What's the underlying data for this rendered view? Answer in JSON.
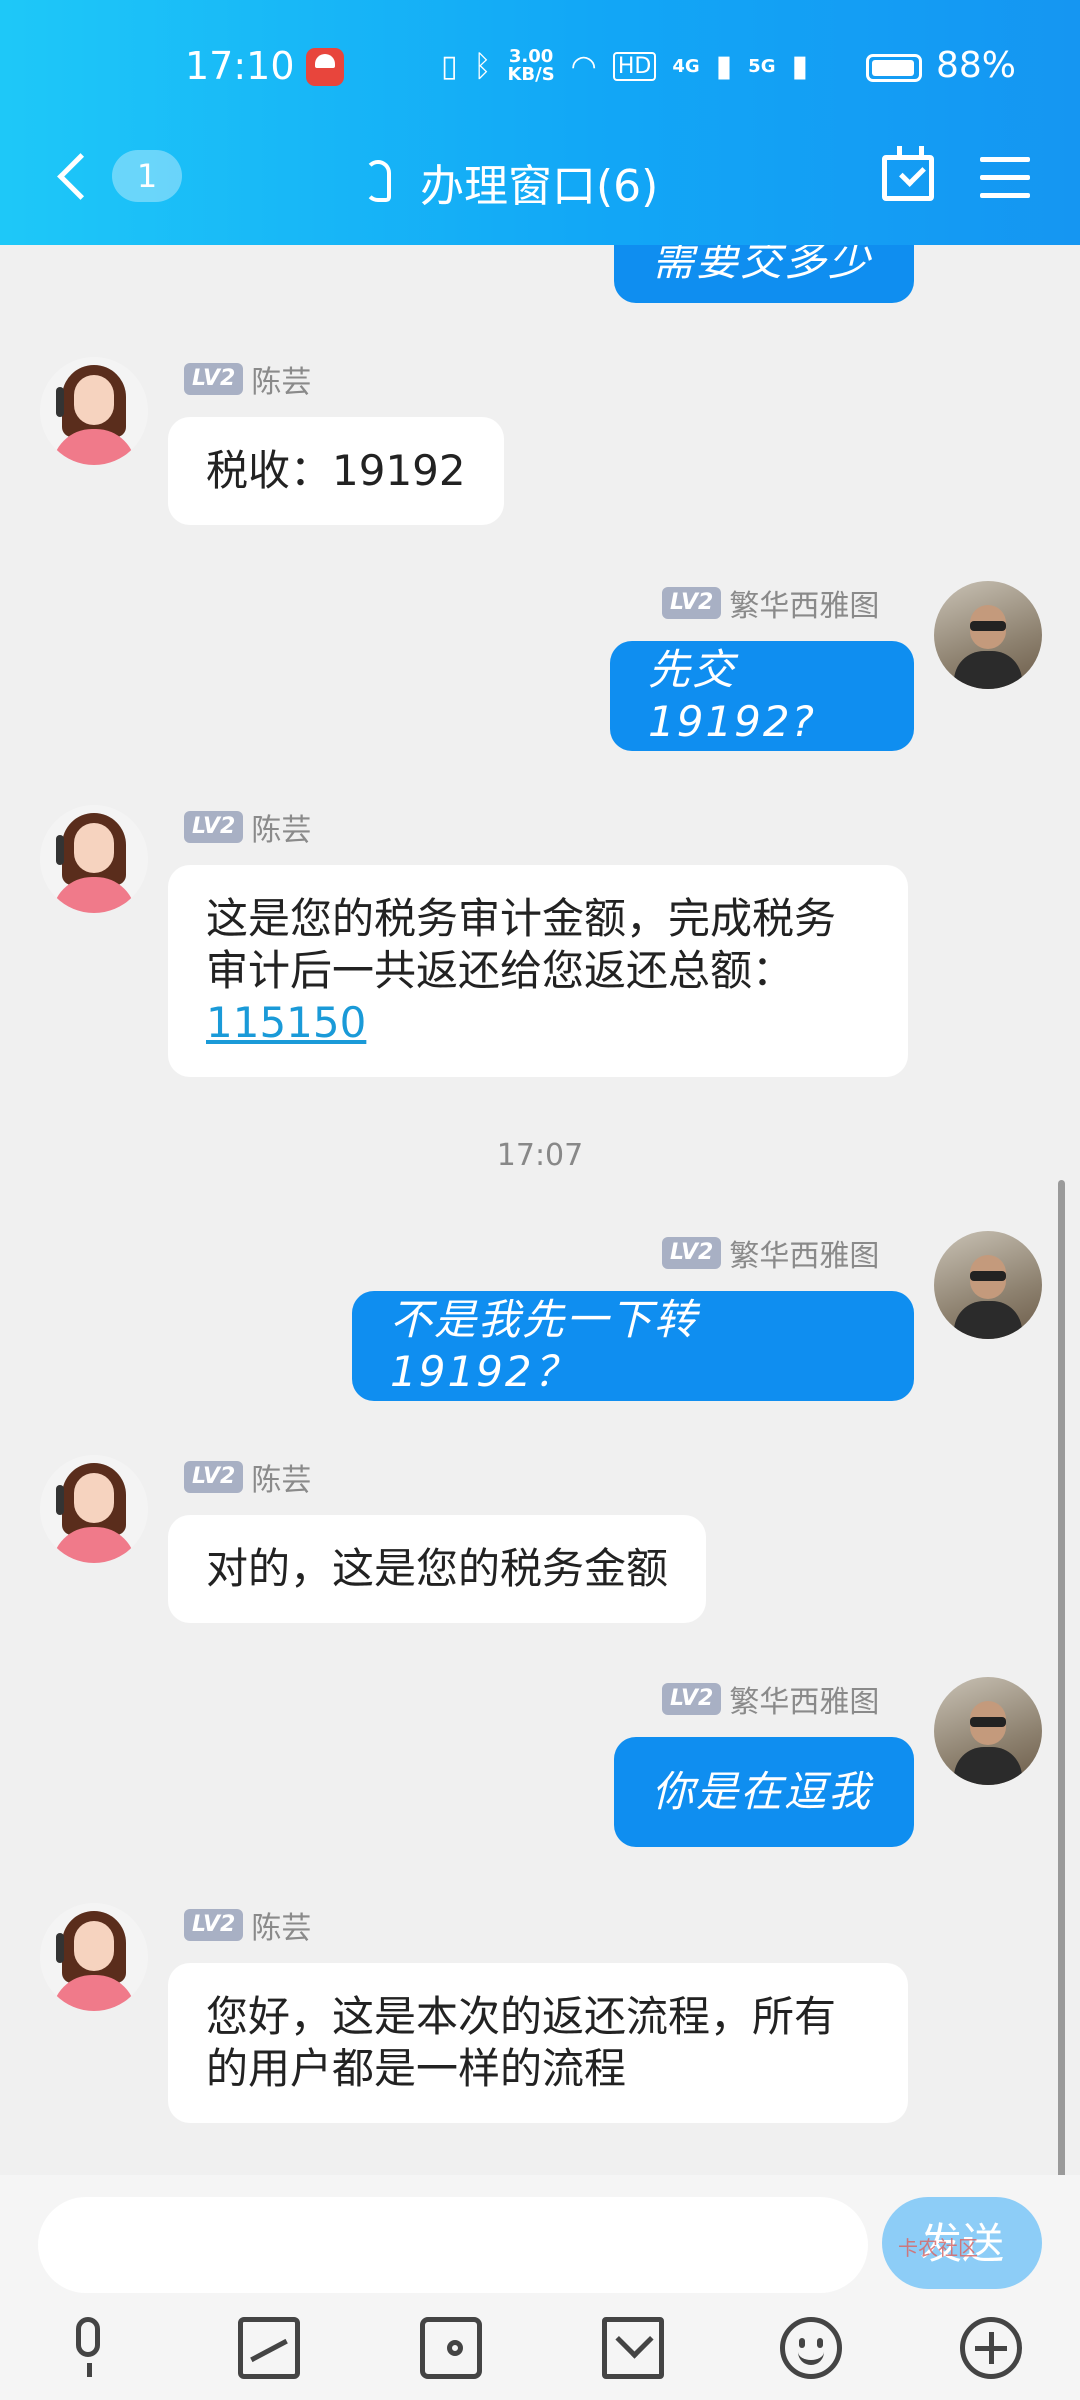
{
  "status": {
    "time": "17:10",
    "speed_value": "3.00",
    "speed_unit": "KB/S",
    "hd": "HD",
    "net1": "4G",
    "net2": "5G",
    "battery": "88%"
  },
  "header": {
    "unread_count": "1",
    "title": "办理窗口(6)"
  },
  "badge": "LV2",
  "agent_name": "陈芸",
  "user_name": "繁华西雅图",
  "top_partial_bubble": "需要交多少",
  "messages": {
    "m1": "税收：19192",
    "m2": "先交19192?",
    "m3_prefix": "这是您的税务审计金额，完成税务审计后一共返还给您返还总额：",
    "m3_link": "115150",
    "time_divider": "17:07",
    "m4": "不是我先一下转19192？",
    "m5": "对的，这是您的税务金额",
    "m6": "你是在逗我",
    "m7": "您好，这是本次的返还流程，所有的用户都是一样的流程"
  },
  "input": {
    "value": "",
    "send_label": "发送"
  },
  "watermark": "卡农社区"
}
